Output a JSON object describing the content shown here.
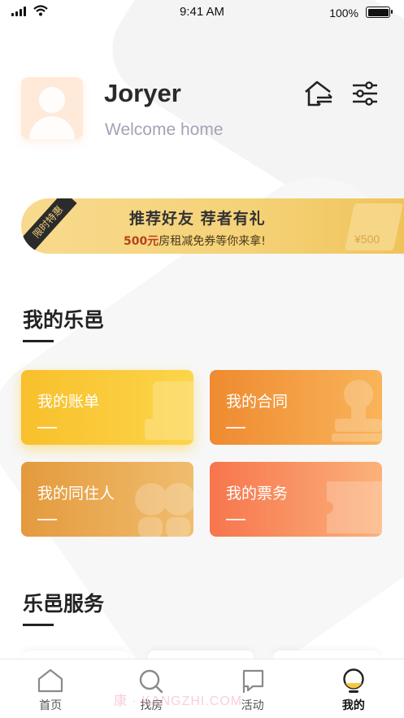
{
  "status_bar": {
    "time": "9:41 AM",
    "battery": "100%"
  },
  "profile": {
    "username": "Joryer",
    "subtitle": "Welcome home"
  },
  "promo": {
    "badge": "限时特惠",
    "title": "推荐好友  荐者有礼",
    "desc_highlight": "500元",
    "desc_rest": "房租减免券等你来拿!",
    "coupon_amount": "¥500"
  },
  "section_my": {
    "title": "我的乐邑"
  },
  "cards": [
    {
      "label": "我的账单"
    },
    {
      "label": "我的合同"
    },
    {
      "label": "我的同住人"
    },
    {
      "label": "我的票务"
    }
  ],
  "section_service": {
    "title": "乐邑服务"
  },
  "tabbar": [
    {
      "label": "首页",
      "icon": "home-icon"
    },
    {
      "label": "找房",
      "icon": "search-icon"
    },
    {
      "label": "活动",
      "icon": "flag-icon"
    },
    {
      "label": "我的",
      "icon": "profile-icon",
      "active": true
    }
  ],
  "watermark": "康 · KANGZHI.COM",
  "colors": {
    "accent": "#f5c842",
    "text_dark": "#222222",
    "subtitle": "#a4a3b6"
  }
}
